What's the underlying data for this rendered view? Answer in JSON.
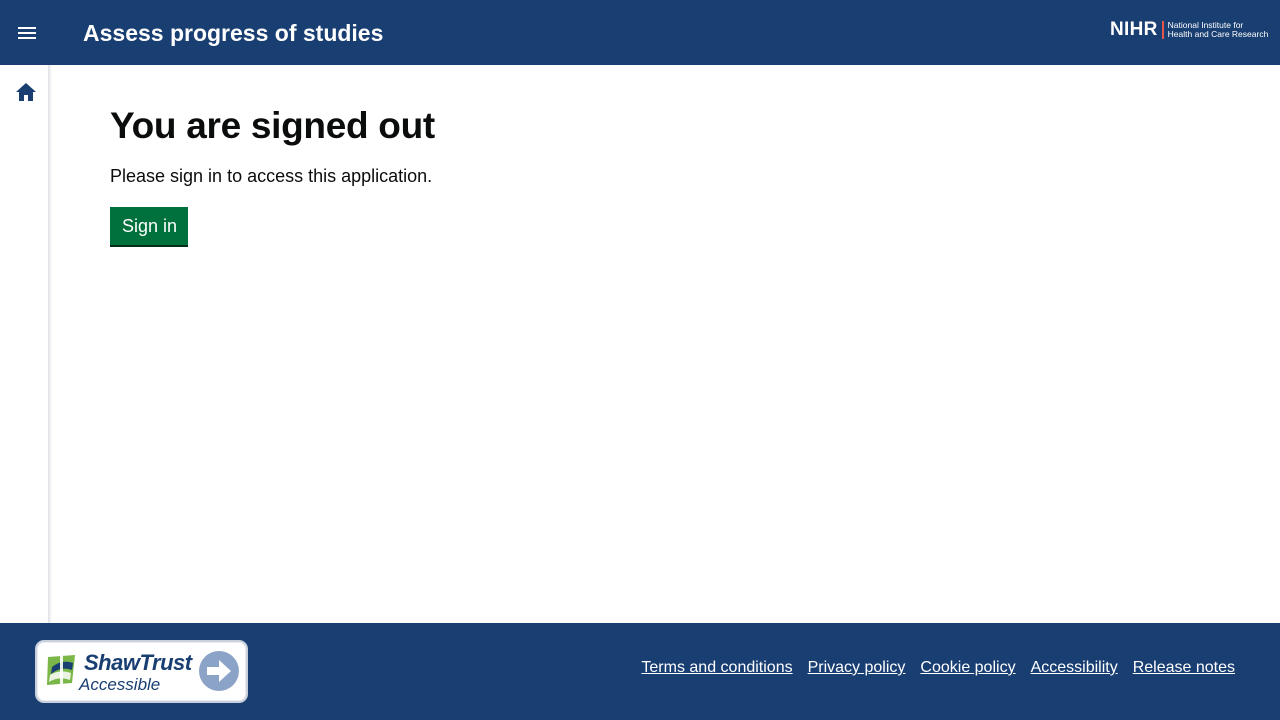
{
  "header": {
    "menu_icon": "hamburger-menu-icon",
    "title": "Assess progress of studies",
    "logo": {
      "mark": "NIHR",
      "line1": "National Institute for",
      "line2": "Health and Care Research"
    }
  },
  "sidebar": {
    "home_icon": "home-icon"
  },
  "main": {
    "heading": "You are signed out",
    "intro": "Please sign in to access this application.",
    "sign_in_label": "Sign in"
  },
  "footer": {
    "badge": {
      "title": "ShawTrust",
      "subtitle": "Accessible"
    },
    "links": [
      "Terms and conditions",
      "Privacy policy",
      "Cookie policy",
      "Accessibility",
      "Release notes"
    ]
  },
  "colors": {
    "header_bg": "#193e72",
    "button_bg": "#00703c",
    "footer_bg": "#193e72",
    "logo_accent": "#e6554c"
  }
}
